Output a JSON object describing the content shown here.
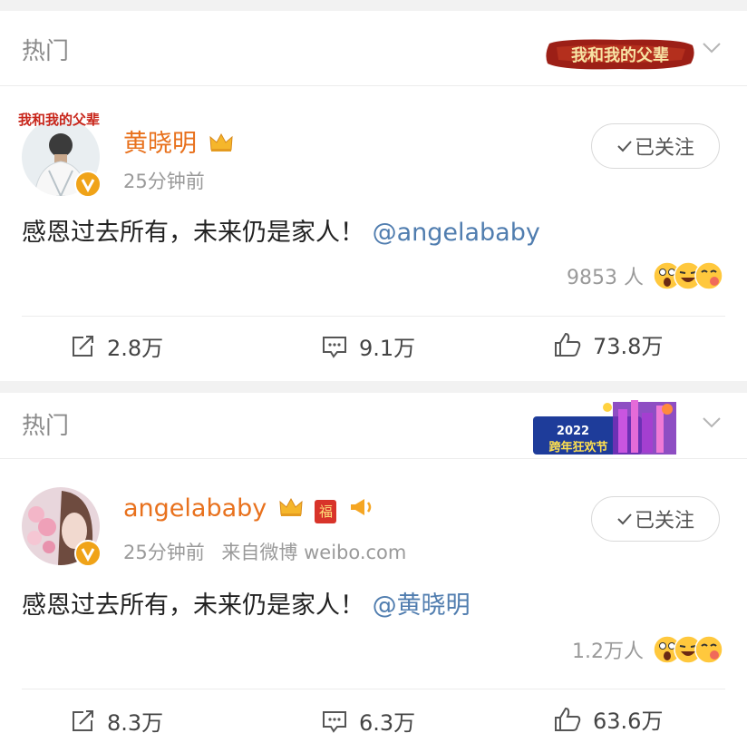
{
  "posts": [
    {
      "section_label": "热门",
      "user": {
        "name": "黄晓明",
        "crown": "crown-icon"
      },
      "meta": {
        "time": "25分钟前",
        "source": ""
      },
      "follow_label": "已关注",
      "text": {
        "body": "感恩过去所有，未来仍是家人！",
        "mention": "@angelababy"
      },
      "reactions": {
        "count": "9853 人"
      },
      "actions": {
        "repost": "2.8万",
        "comment": "9.1万",
        "like": "73.8万"
      }
    },
    {
      "section_label": "热门",
      "user": {
        "name": "angelababy",
        "crown": "crown-icon",
        "badge_fu": "福"
      },
      "meta": {
        "time": "25分钟前",
        "source": "来自微博 weibo.com"
      },
      "follow_label": "已关注",
      "text": {
        "body": "感恩过去所有，未来仍是家人！",
        "mention": "@黄晓明"
      },
      "reactions": {
        "count": "1.2万人"
      },
      "actions": {
        "repost": "8.3万",
        "comment": "6.3万",
        "like": "63.6万"
      }
    }
  ],
  "banners": {
    "film": {
      "text": "我和我的父辈"
    },
    "festival": {
      "year": "2022",
      "title": "跨年狂欢节"
    }
  },
  "colors": {
    "accent_name": "#e8711d",
    "mention": "#507daf",
    "badge": "#f0a318"
  }
}
